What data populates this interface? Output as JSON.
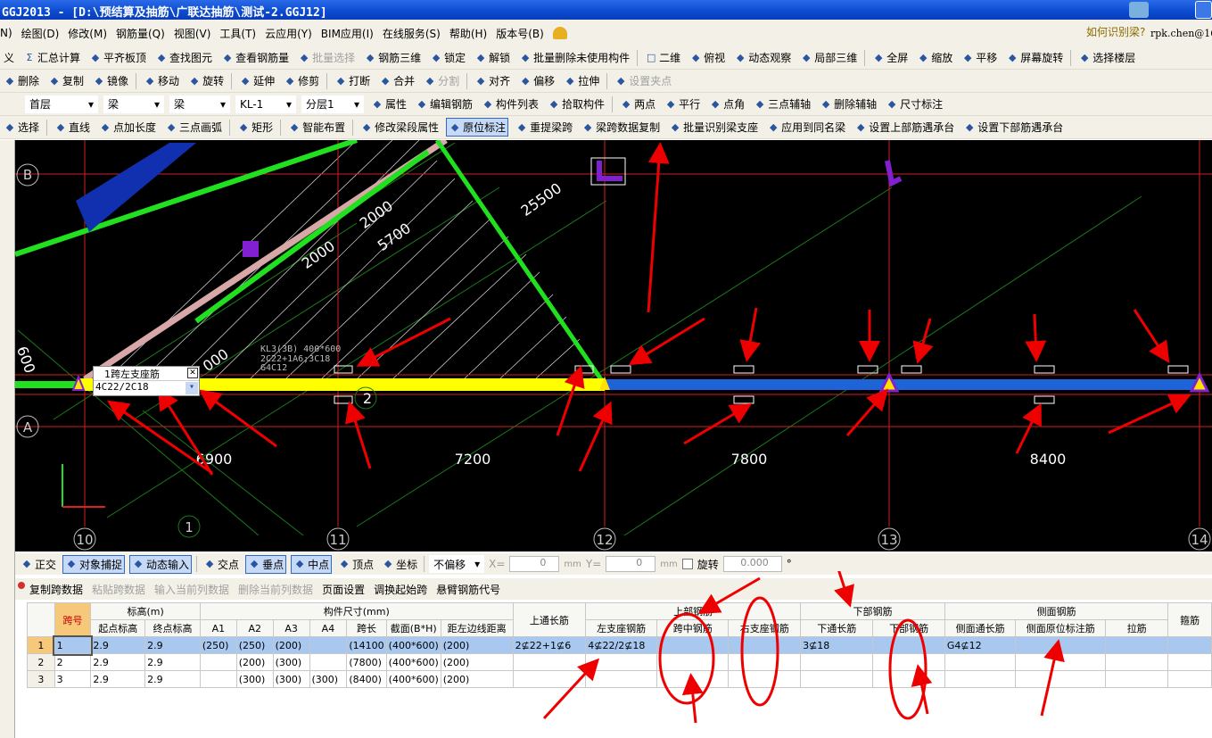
{
  "window": {
    "title": "GGJ2013 - [D:\\预结算及抽筋\\广联达抽筋\\测试-2.GGJ12]"
  },
  "menu": {
    "items": [
      "绘图(D)",
      "修改(M)",
      "钢筋量(Q)",
      "视图(V)",
      "工具(T)",
      "云应用(Y)",
      "BIM应用(I)",
      "在线服务(S)",
      "帮助(H)",
      "版本号(B)"
    ],
    "help_link": "如何识别梁?",
    "user": "rpk.chen@163",
    "left_cut": "N)"
  },
  "toolbar1": {
    "items": [
      "义",
      "汇总计算",
      "平齐板顶",
      "查找图元",
      "查看钢筋量",
      "批量选择",
      "钢筋三维",
      "锁定",
      "解锁",
      "批量删除未使用构件",
      "二维",
      "俯视",
      "动态观察",
      "局部三维",
      "全屏",
      "缩放",
      "平移",
      "屏幕旋转",
      "选择楼层"
    ]
  },
  "toolbar2": {
    "items": [
      "删除",
      "复制",
      "镜像",
      "移动",
      "旋转",
      "延伸",
      "修剪",
      "打断",
      "合并",
      "分割",
      "对齐",
      "偏移",
      "拉伸",
      "设置夹点"
    ]
  },
  "toolbar3": {
    "floor": "首层",
    "type1": "梁",
    "type2": "梁",
    "component": "KL-1",
    "layer": "分层1",
    "items": [
      "属性",
      "编辑钢筋",
      "构件列表",
      "拾取构件",
      "两点",
      "平行",
      "点角",
      "三点辅轴",
      "删除辅轴",
      "尺寸标注"
    ]
  },
  "toolbar4": {
    "items": [
      "选择",
      "直线",
      "点加长度",
      "三点画弧",
      "矩形",
      "智能布置",
      "修改梁段属性",
      "原位标注",
      "重提梁跨",
      "梁跨数据复制",
      "批量识别梁支座",
      "应用到同名梁",
      "设置上部筋遇承台",
      "设置下部筋遇承台"
    ]
  },
  "canvas": {
    "axes_bottom": [
      "10",
      "11",
      "12",
      "13",
      "14"
    ],
    "axes_left": [
      "B",
      "A"
    ],
    "dimensions": [
      "6900",
      "7200",
      "7800",
      "8400"
    ],
    "diag_dims": [
      "2000",
      "2000",
      "5700",
      "25500",
      "000"
    ],
    "left_dim": "600",
    "span_label": "2",
    "axis_circle": "1",
    "beam_note": [
      "KL3(3B) 400*600",
      "2C22+1A6;3C18",
      "G4C12"
    ],
    "popup": {
      "title": "1跨左支座筋",
      "value": "4C22/2C18"
    },
    "colors": {
      "background": "#000000",
      "beam_left": "#ffff00",
      "beam_right": "#1e64d8",
      "grid_line": "#d02020",
      "wall": "#20e020"
    }
  },
  "snapbar": {
    "items": [
      "正交",
      "对象捕捉",
      "动态输入",
      "交点",
      "垂点",
      "中点",
      "顶点",
      "坐标"
    ],
    "offset": "不偏移",
    "x_label": "X=",
    "x_value": "0",
    "y_label": "Y=",
    "y_value": "0",
    "unit": "mm",
    "rotate_label": "旋转",
    "rotate_value": "0.000",
    "degree": "°"
  },
  "tablebar": {
    "items": [
      "复制跨数据",
      "粘贴跨数据",
      "输入当前列数据",
      "删除当前列数据",
      "页面设置",
      "调换起始跨",
      "悬臂钢筋代号"
    ]
  },
  "table": {
    "group_headers": [
      "跨号",
      "标高(m)",
      "构件尺寸(mm)",
      "上通长筋",
      "上部钢筋",
      "下部钢筋",
      "侧面钢筋",
      "箍筋"
    ],
    "sub_headers": [
      "起点标高",
      "终点标高",
      "A1",
      "A2",
      "A3",
      "A4",
      "跨长",
      "截面(B*H)",
      "距左边线距离",
      "左支座钢筋",
      "跨中钢筋",
      "右支座钢筋",
      "下通长筋",
      "下部钢筋",
      "侧面通长筋",
      "侧面原位标注筋",
      "拉筋"
    ],
    "rows": [
      [
        "1",
        "1",
        "2.9",
        "2.9",
        "(250)",
        "(250)",
        "(200)",
        "",
        "(14100",
        "(400*600)",
        "(200)",
        "2⊈22+1⊈6",
        "4⊈22/2⊈18",
        "",
        "",
        "3⊈18",
        "",
        "G4⊈12",
        "",
        "",
        ""
      ],
      [
        "2",
        "2",
        "2.9",
        "2.9",
        "",
        "(200)",
        "(300)",
        "",
        "(7800)",
        "(400*600)",
        "(200)",
        "",
        "",
        "",
        "",
        "",
        "",
        "",
        "",
        "",
        ""
      ],
      [
        "3",
        "3",
        "2.9",
        "2.9",
        "",
        "(300)",
        "(300)",
        "(300)",
        "(8400)",
        "(400*600)",
        "(200)",
        "",
        "",
        "",
        "",
        "",
        "",
        "",
        "",
        "",
        ""
      ]
    ],
    "selected_row": 1
  }
}
